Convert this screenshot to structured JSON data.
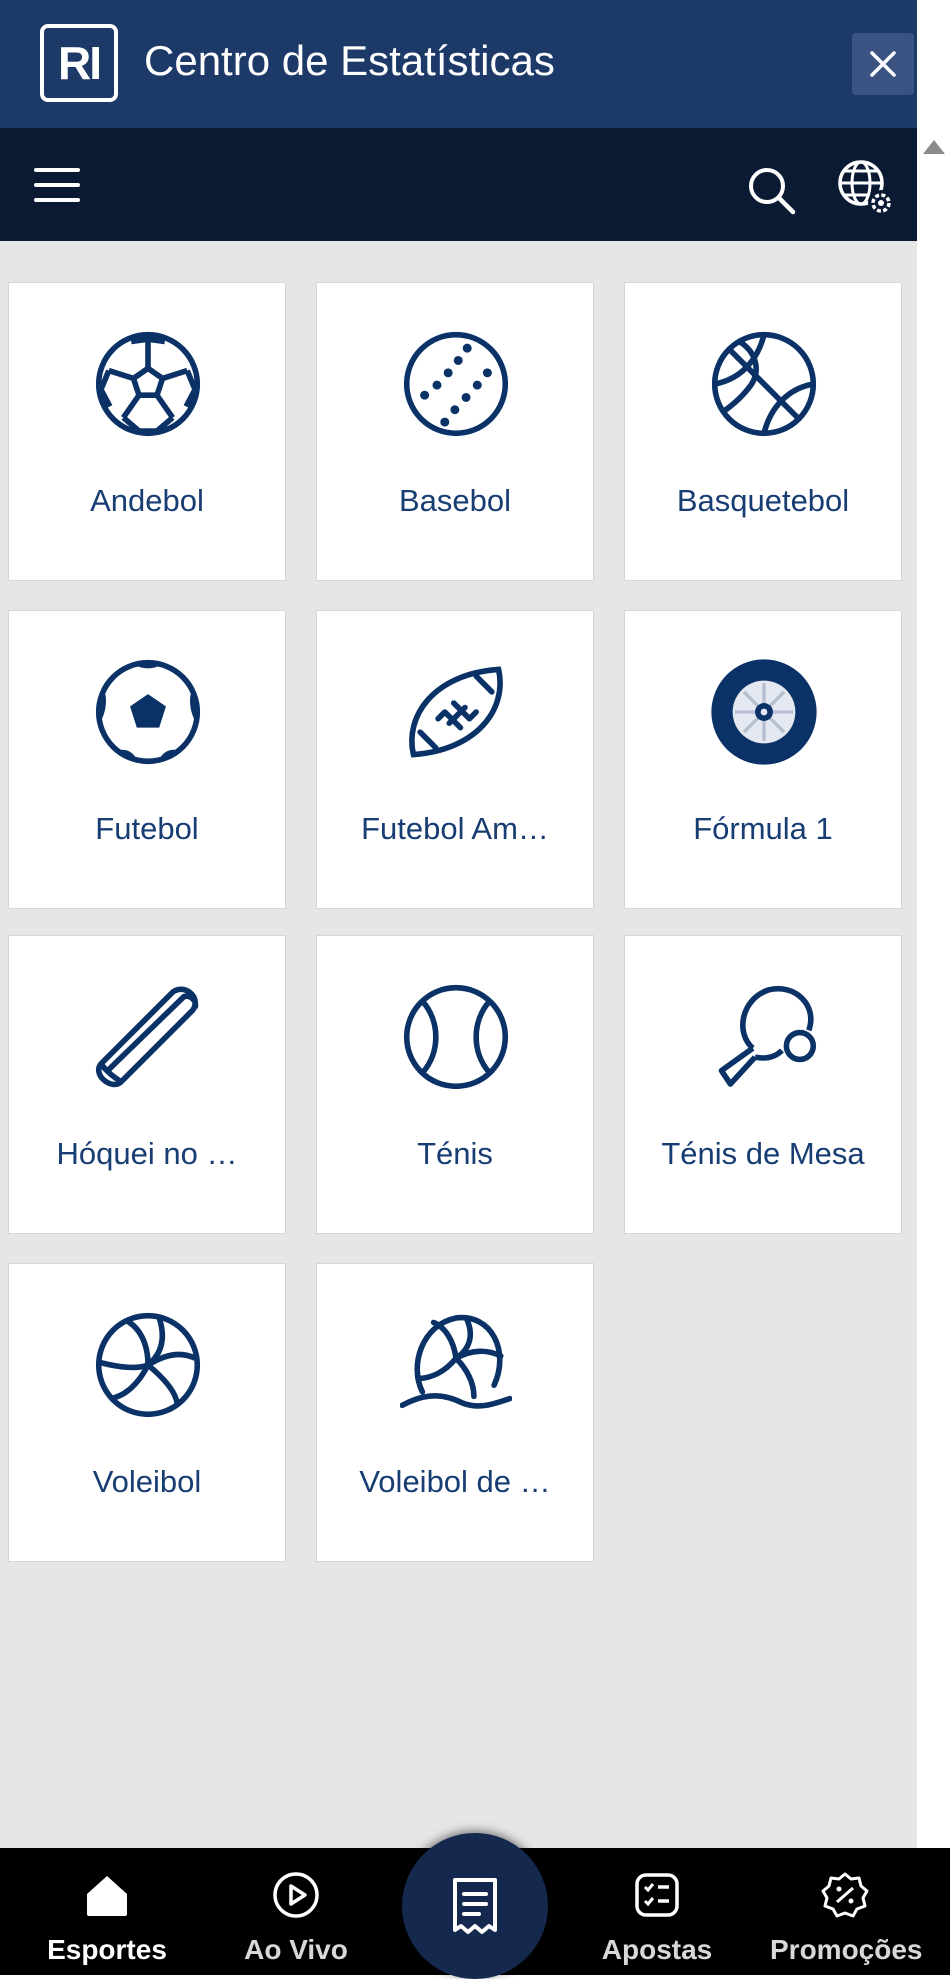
{
  "header": {
    "logo_text": "RI",
    "title": "Centro de Estatísticas",
    "close_icon": "close-icon"
  },
  "toolbar": {
    "menu_icon": "hamburger-menu-icon",
    "search_icon": "search-icon",
    "language_icon": "globe-settings-icon"
  },
  "sports": [
    {
      "label": "Andebol",
      "icon": "handball-icon"
    },
    {
      "label": "Basebol",
      "icon": "baseball-icon"
    },
    {
      "label": "Basquetebol",
      "icon": "basketball-icon"
    },
    {
      "label": "Futebol",
      "icon": "soccer-ball-icon"
    },
    {
      "label": "Futebol Am…",
      "icon": "american-football-icon"
    },
    {
      "label": "Fórmula 1",
      "icon": "formula1-wheel-icon"
    },
    {
      "label": "Hóquei no …",
      "icon": "hockey-puck-icon"
    },
    {
      "label": "Ténis",
      "icon": "tennis-ball-icon"
    },
    {
      "label": "Ténis de Mesa",
      "icon": "table-tennis-icon"
    },
    {
      "label": "Voleibol",
      "icon": "volleyball-icon"
    },
    {
      "label": "Voleibol de …",
      "icon": "beach-volleyball-icon"
    }
  ],
  "bottom_nav": {
    "items": [
      {
        "label": "Esportes",
        "icon": "home-icon"
      },
      {
        "label": "Ao Vivo",
        "icon": "play-circle-icon"
      },
      {
        "label": "Apostas",
        "icon": "bet-list-icon"
      },
      {
        "label": "Promoções",
        "icon": "promo-badge-icon"
      }
    ],
    "center_icon": "betslip-icon"
  },
  "colors": {
    "header_bg": "#1d3968",
    "toolbar_bg": "#0b1a33",
    "content_bg": "#e6e6e6",
    "icon_color": "#0b3266",
    "label_color": "#173d73"
  }
}
